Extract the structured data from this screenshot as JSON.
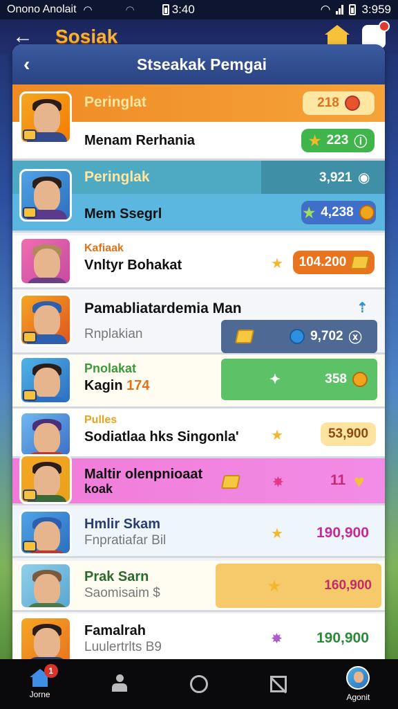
{
  "status_bar": {
    "carrier": "Onono Anolait",
    "time_left": "3:40",
    "time_right": "3:959"
  },
  "app_bar": {
    "back_icon": "arrow-left-icon",
    "title": "Sosiak"
  },
  "panel": {
    "back_icon": "chevron-left-icon",
    "title": "Stseakak Pemgai"
  },
  "rows": [
    {
      "rank_title": "Peringlat",
      "name": "Menam Rerhania",
      "value_top": "218",
      "value_bottom": "223",
      "colors": {
        "top": "#f08a24",
        "bottom_pill": "#3fb54b",
        "top_pill": "#fde7a3"
      }
    },
    {
      "rank_title": "Peringlak",
      "name": "Mem Ssegrl",
      "value_top": "3,921",
      "value_bottom": "4,238",
      "colors": {
        "top": "#4ba6c4",
        "bottom_pill": "#3f6fc9"
      }
    },
    {
      "tag": "Kafiaak",
      "name": "Vnltyr Bohakat",
      "value": "104.200"
    },
    {
      "name": "Pamabliatardemia Man",
      "sub": "Rnplakian",
      "value": "9,702"
    },
    {
      "tag": "Pnolakat",
      "name": "Kagin",
      "name_extra": "174",
      "value": "358"
    },
    {
      "tag": "Pulles",
      "name": "Sodiatlaa hks Singonla'",
      "value": "53,900"
    },
    {
      "name": "Maltir olenpnioaat",
      "sub": "koak",
      "value": "11"
    },
    {
      "name": "Hmlir Skam",
      "sub": "Fnpratiafar",
      "sub_extra": "Bil",
      "value": "190,900"
    },
    {
      "name": "Prak Sarn",
      "sub": "Saomisaim",
      "sub_extra": "$",
      "value": "160,900"
    },
    {
      "name": "Famalrah",
      "sub": "Luulertrlts",
      "sub_extra": "B9",
      "value": "190,900"
    }
  ],
  "bottom_nav": {
    "home_label": "Jorne",
    "home_badge": "1",
    "profile_label": "Agonit"
  }
}
